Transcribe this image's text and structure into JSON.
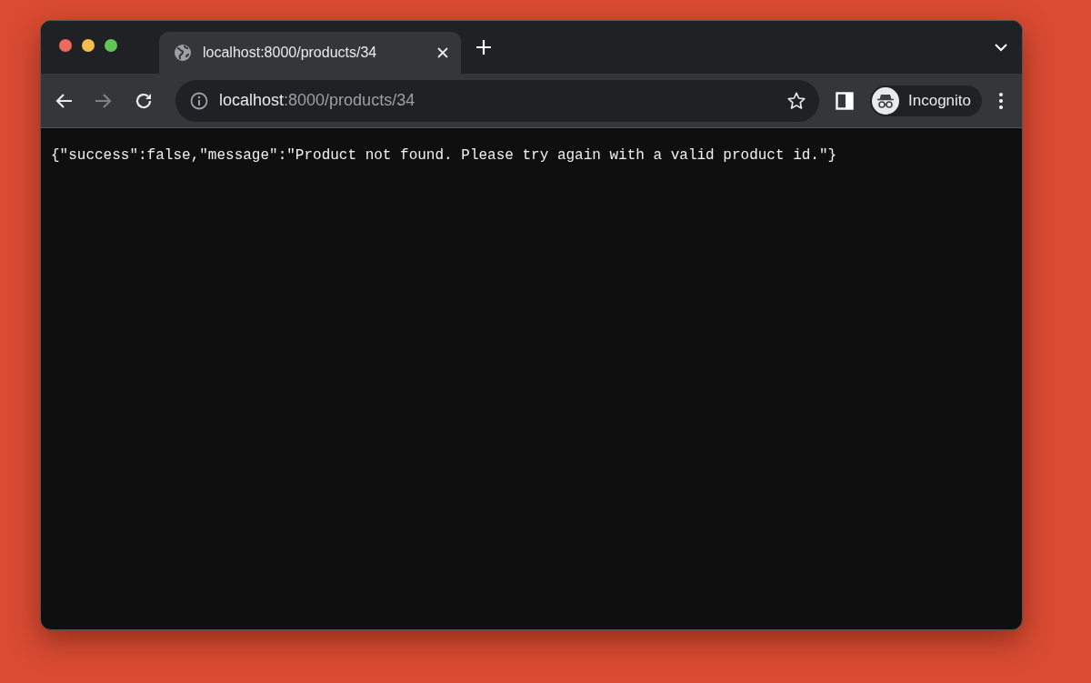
{
  "tabs": [
    {
      "title": "localhost:8000/products/34",
      "selected": true
    }
  ],
  "toolbar": {
    "nav_buttons": [
      {
        "kind": "back",
        "disabled": false
      },
      {
        "kind": "forward",
        "disabled": true
      },
      {
        "kind": "reload",
        "disabled": false
      }
    ],
    "address": {
      "host": "localhost",
      "path": ":8000/products/34"
    },
    "profile": {
      "label": "Incognito"
    }
  },
  "page": {
    "body": "{\"success\":false,\"message\":\"Product not found. Please try again with a valid product id.\"}"
  }
}
